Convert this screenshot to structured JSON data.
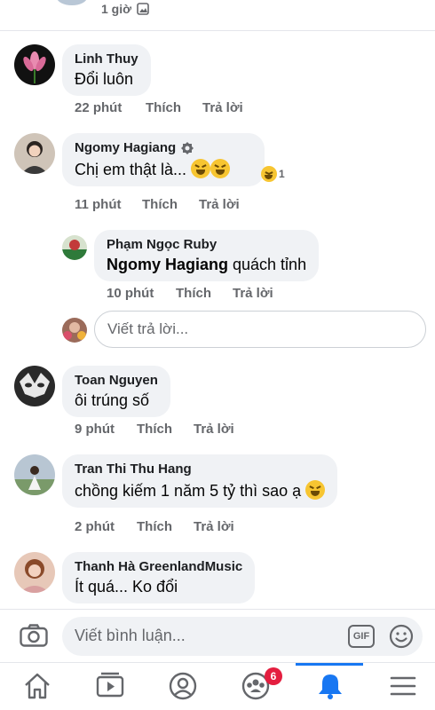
{
  "top": {
    "time": "1 giờ"
  },
  "comments": [
    {
      "author": "Linh Thuy",
      "text": "Đổi luôn",
      "time": "22 phút",
      "like": "Thích",
      "reply": "Trả lời"
    },
    {
      "author": "Ngomy Hagiang",
      "text": "Chị em thật là...",
      "time": "11 phút",
      "like": "Thích",
      "reply": "Trả lời",
      "reaction_count": "1"
    },
    {
      "author": "Toan Nguyen",
      "text": "ôi trúng số",
      "time": "9 phút",
      "like": "Thích",
      "reply": "Trả lời"
    },
    {
      "author": "Tran Thi Thu Hang",
      "text": "chồng kiếm 1 năm 5 tỷ thì sao ạ",
      "time": "2 phút",
      "like": "Thích",
      "reply": "Trả lời"
    },
    {
      "author": "Thanh Hà GreenlandMusic",
      "text": "Ít quá... Ko đổi"
    }
  ],
  "reply": {
    "author": "Phạm Ngọc Ruby",
    "mention": "Ngomy Hagiang",
    "text": " quách tỉnh",
    "time": "10 phút",
    "like": "Thích",
    "reply": "Trả lời"
  },
  "reply_box": {
    "placeholder": "Viết trả lời..."
  },
  "composer": {
    "placeholder": "Viết bình luận...",
    "gif_label": "GIF"
  },
  "nav": {
    "groups_badge": "6"
  },
  "colors": {
    "accent": "#1877f2",
    "badge": "#e41e3f",
    "bubble": "#f0f2f5",
    "muted": "#65676b"
  },
  "icons": [
    "gallery-icon",
    "verified-icon",
    "camera-icon",
    "gif-icon",
    "smile-icon",
    "home-icon",
    "watch-icon",
    "profile-icon",
    "groups-icon",
    "bell-icon",
    "menu-icon"
  ]
}
